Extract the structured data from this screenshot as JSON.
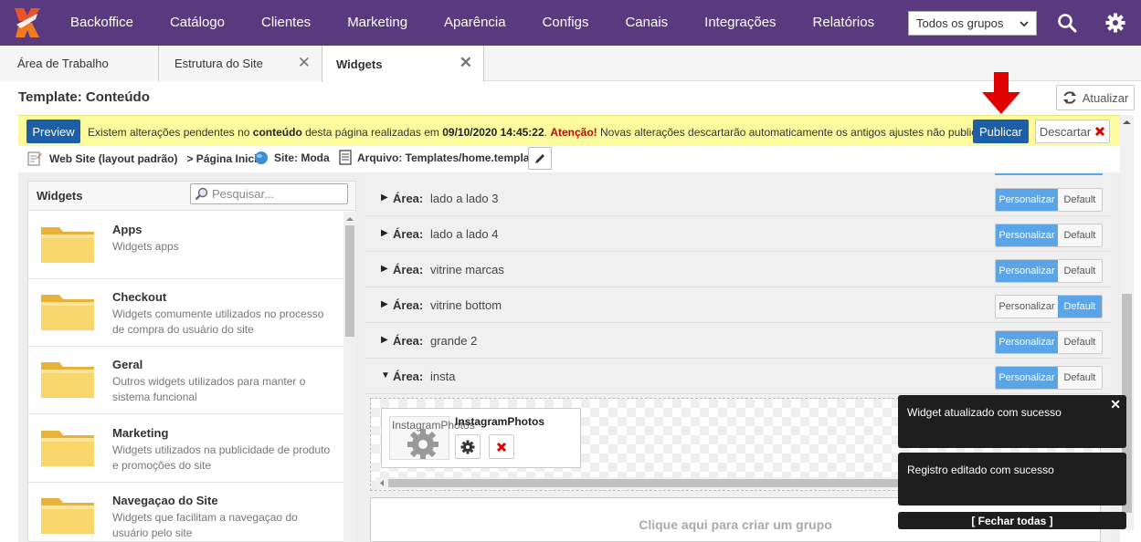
{
  "topnav": {
    "items": [
      "Backoffice",
      "Catálogo",
      "Clientes",
      "Marketing",
      "Aparência",
      "Configs",
      "Canais",
      "Integrações",
      "Relatórios"
    ],
    "group_select": "Todos os grupos",
    "bg_color": "#5a3a7e"
  },
  "tabs": [
    {
      "label": "Área de Trabalho"
    },
    {
      "label": "Estrutura do Site"
    },
    {
      "label": "Widgets"
    }
  ],
  "template": {
    "title": "Template: Conteúdo",
    "refresh_label": "Atualizar"
  },
  "notice": {
    "preview_label": "Preview",
    "text_a": "Existem alterações pendentes no ",
    "text_b": "conteúdo",
    "text_c": " desta página realizadas em ",
    "text_d": "09/10/2020 14:45:22",
    "text_e": ". ",
    "text_warn": "Atenção!",
    "text_f": " Novas alterações descartarão automaticamente os antigos ajustes não publicados.",
    "publish_label": "Publicar",
    "discard_label": "Descartar"
  },
  "info": {
    "website": "Web Site (layout padrão)",
    "page": "> Página Inicial",
    "site": "Site: Moda",
    "file": "Arquivo: Templates/home.template"
  },
  "widgets": {
    "title": "Widgets",
    "search_placeholder": "Pesquisar...",
    "items": [
      {
        "name": "Apps",
        "desc": "Widgets apps"
      },
      {
        "name": "Checkout",
        "desc": "Widgets comumente utilizados no processo de compra do usuário do site"
      },
      {
        "name": "Geral",
        "desc": "Outros widgets utilizados para manter o sistema funcional"
      },
      {
        "name": "Marketing",
        "desc": "Widgets utilizados na publicidade de produto e promoções do site"
      },
      {
        "name": "Navegaçao do Site",
        "desc": "Widgets que facilitam a navegaçao do usuário pelo site"
      }
    ]
  },
  "areas": {
    "label": "Área:",
    "personalizar": "Personalizar",
    "default": "Default",
    "rows": [
      {
        "name": "lado a lado 3",
        "mode": "Personalizar",
        "expanded": false
      },
      {
        "name": "lado a lado 4",
        "mode": "Personalizar",
        "expanded": false
      },
      {
        "name": "vitrine marcas",
        "mode": "Personalizar",
        "expanded": false
      },
      {
        "name": "vitrine bottom",
        "mode": "Default",
        "expanded": false
      },
      {
        "name": "grande 2",
        "mode": "Personalizar",
        "expanded": false
      },
      {
        "name": "insta",
        "mode": "Personalizar",
        "expanded": true
      }
    ],
    "widget_card": {
      "name": "InstagramPhotos",
      "img_alt": "InstagramPhotos"
    },
    "create_group": "Clique aqui para criar um grupo"
  },
  "toasts": [
    {
      "message": "Widget atualizado com sucesso"
    },
    {
      "message": "Registro editado com sucesso"
    }
  ],
  "close_all": "[ Fechar todas ]"
}
